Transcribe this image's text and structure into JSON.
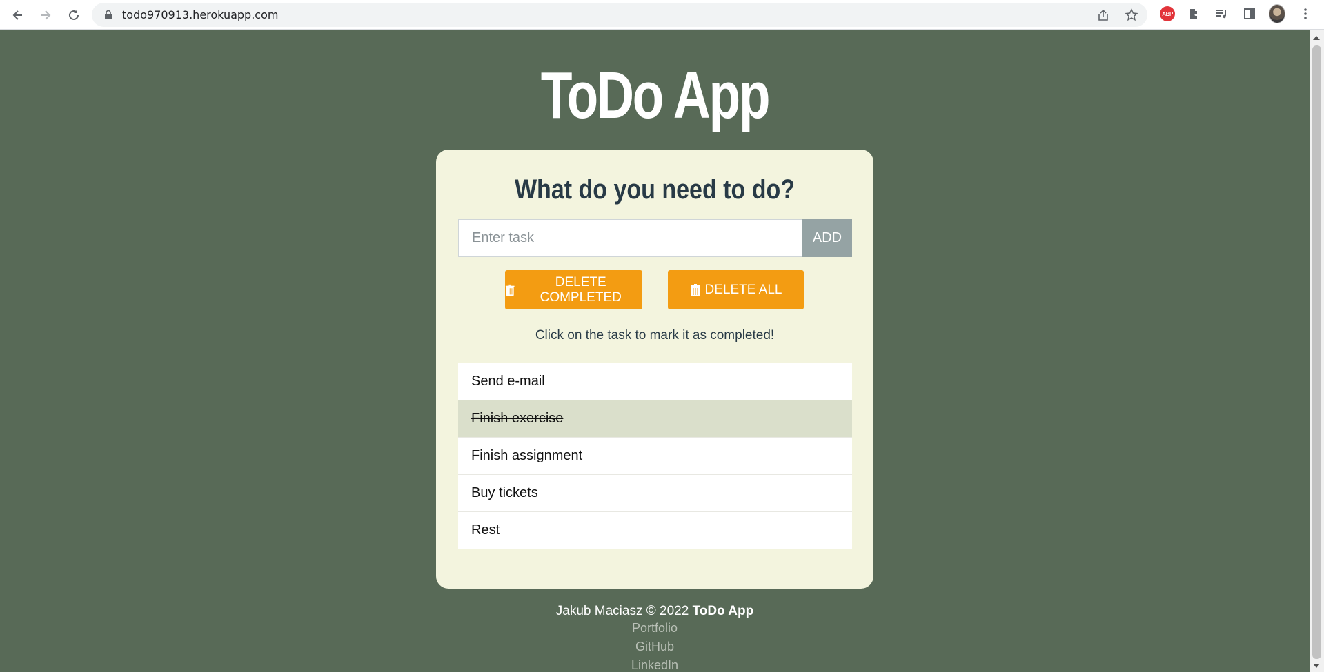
{
  "browser": {
    "url": "todo970913.herokuapp.com"
  },
  "app": {
    "title": "ToDo App",
    "heading": "What do you need to do?",
    "input_placeholder": "Enter task",
    "add_label": "ADD",
    "delete_completed_label": "DELETE COMPLETED",
    "delete_all_label": "DELETE ALL",
    "hint": "Click on the task to mark it as completed!",
    "tasks": [
      {
        "text": "Send e-mail",
        "completed": false
      },
      {
        "text": "Finish exercise",
        "completed": true
      },
      {
        "text": "Finish assignment",
        "completed": false
      },
      {
        "text": "Buy tickets",
        "completed": false
      },
      {
        "text": "Rest",
        "completed": false
      }
    ]
  },
  "footer": {
    "author": "Jakub Maciasz © 2022",
    "brand": "ToDo App",
    "links": [
      "Portfolio",
      "GitHub",
      "LinkedIn"
    ]
  },
  "colors": {
    "background": "#586a57",
    "card": "#f3f4de",
    "accent": "#f39c12",
    "add_button": "#95a3a4",
    "completed_task": "#dadfcb"
  }
}
